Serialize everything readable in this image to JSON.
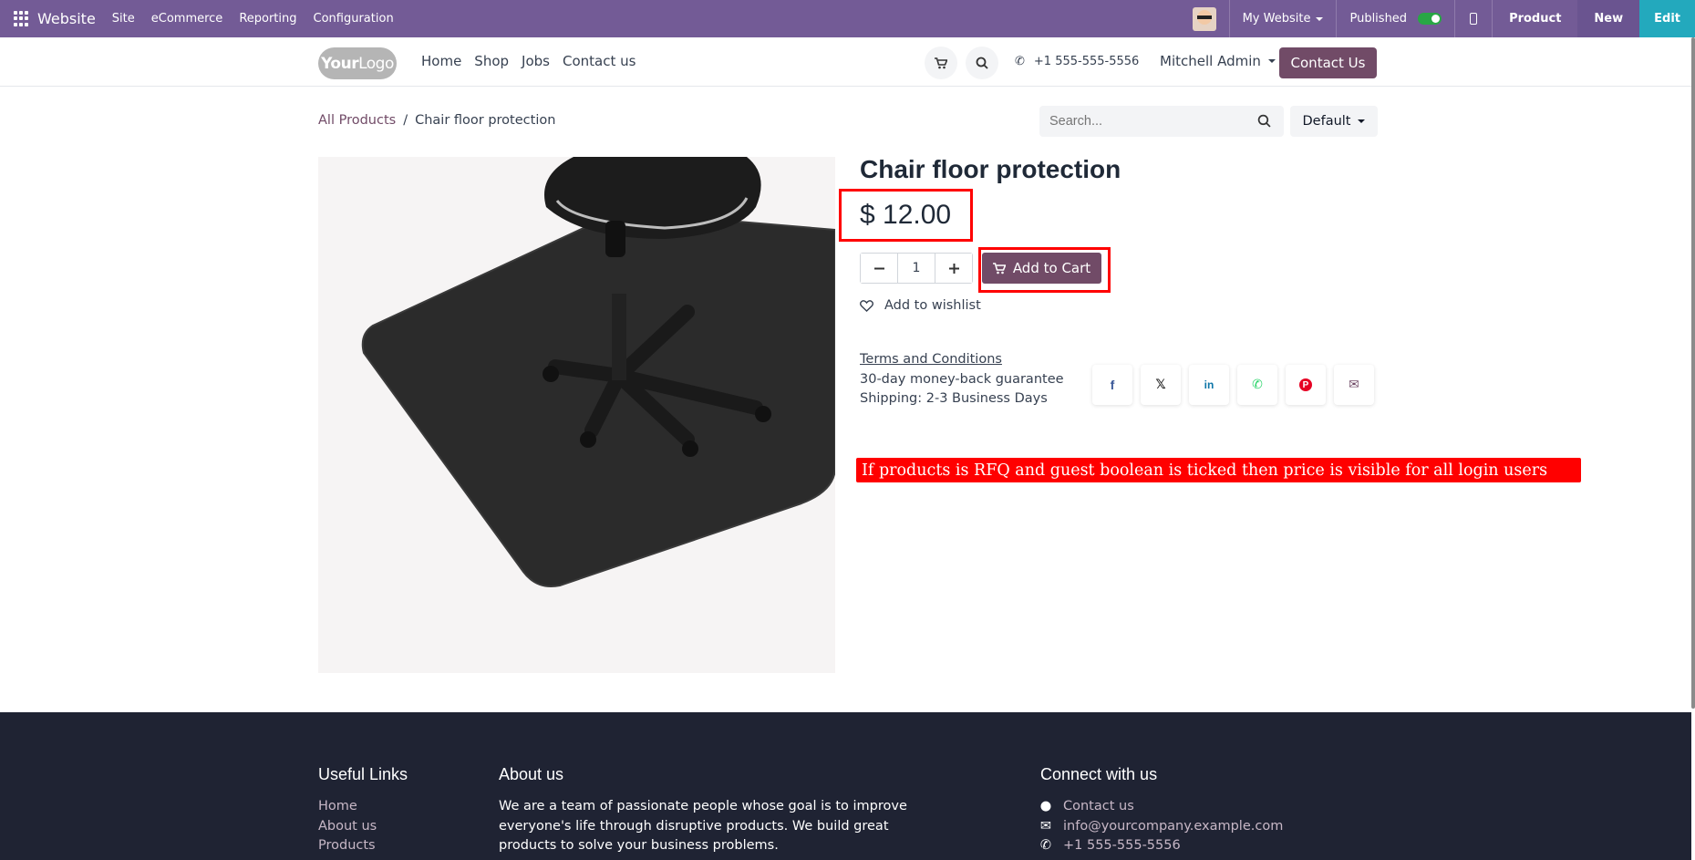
{
  "adminbar": {
    "brand": "Website",
    "menus": [
      "Site",
      "eCommerce",
      "Reporting",
      "Configuration"
    ],
    "website_selector": "My Website",
    "published_label": "Published",
    "published": true,
    "product_label": "Product",
    "new_label": "New",
    "edit_label": "Edit",
    "colors": {
      "bar": "#735b96",
      "edit": "#23a9bd"
    }
  },
  "header": {
    "logo_text_bold": "Your",
    "logo_text": "Logo",
    "nav": [
      "Home",
      "Shop",
      "Jobs",
      "Contact us"
    ],
    "phone": "+1 555-555-5556",
    "user": "Mitchell Admin",
    "contact_button": "Contact Us"
  },
  "breadcrumb": {
    "parent": "All Products",
    "separator": "/",
    "current": "Chair floor protection"
  },
  "search": {
    "placeholder": "Search..."
  },
  "sort": {
    "label": "Default"
  },
  "product": {
    "title": "Chair floor protection",
    "price": "$ 12.00",
    "quantity": "1",
    "add_to_cart": "Add to Cart",
    "wishlist": "Add to wishlist",
    "terms": "Terms and Conditions",
    "guarantee": "30-day money-back guarantee",
    "shipping": "Shipping: 2-3 Business Days",
    "accent": "#714b67"
  },
  "share_icons": [
    {
      "name": "facebook-icon",
      "glyph": "f",
      "color": "#3b5998"
    },
    {
      "name": "x-twitter-icon",
      "glyph": "𝕏",
      "color": "#111111"
    },
    {
      "name": "linkedin-icon",
      "glyph": "in",
      "color": "#0e76a8"
    },
    {
      "name": "whatsapp-icon",
      "glyph": "✆",
      "color": "#25d366"
    },
    {
      "name": "pinterest-icon",
      "glyph": "P",
      "color": "#e60023"
    },
    {
      "name": "email-icon",
      "glyph": "✉",
      "color": "#714b67"
    }
  ],
  "annotation": "If products is RFQ and guest boolean is ticked then price is visible for all login users",
  "footer": {
    "useful_links_title": "Useful Links",
    "useful_links": [
      "Home",
      "About us",
      "Products"
    ],
    "about_title": "About us",
    "about_text": "We are a team of passionate people whose goal is to improve everyone's life through disruptive products. We build great products to solve your business problems.",
    "connect_title": "Connect with us",
    "contact_link": "Contact us",
    "email": "info@yourcompany.example.com",
    "phone": "+1 555-555-5556"
  }
}
